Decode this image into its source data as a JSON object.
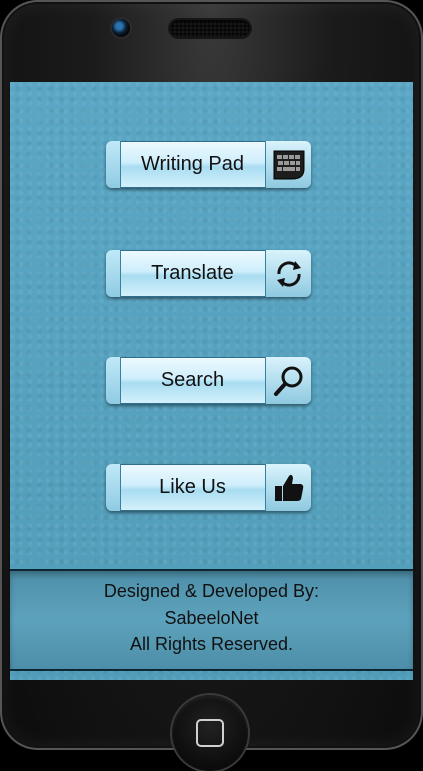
{
  "menu": {
    "buttons": [
      {
        "label": "Writing Pad",
        "icon": "keyboard-icon"
      },
      {
        "label": "Translate",
        "icon": "refresh-icon"
      },
      {
        "label": "Search",
        "icon": "magnifier-icon"
      },
      {
        "label": "Like Us",
        "icon": "thumbs-up-icon"
      }
    ]
  },
  "footer": {
    "line1": "Designed & Developed By:",
    "line2": "SabeeloNet",
    "line3": "All Rights Reserved."
  },
  "colors": {
    "screen_bg": "#5aa4c1",
    "button_light": "#cfeefb",
    "text": "#111111"
  }
}
